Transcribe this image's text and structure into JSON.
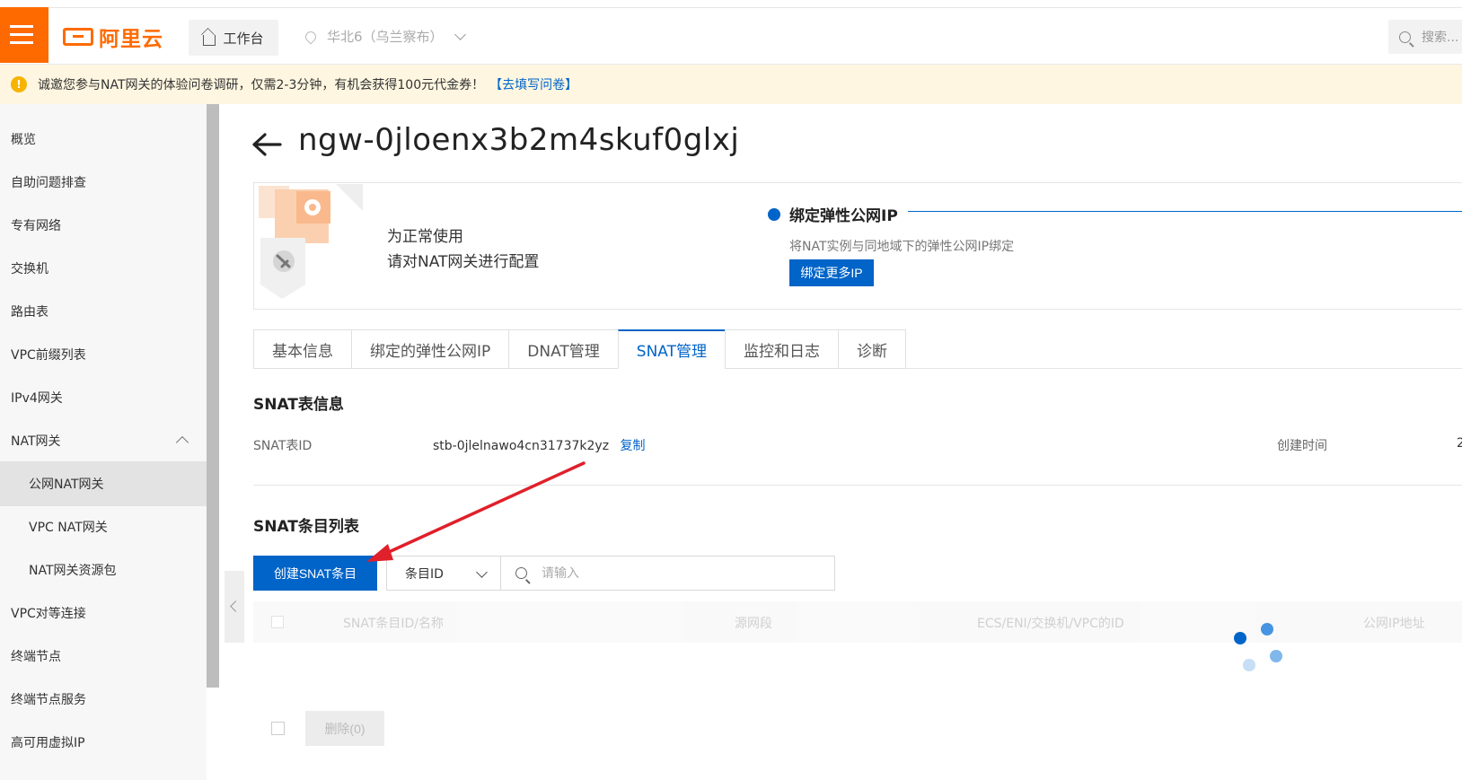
{
  "header": {
    "logo_text": "阿里云",
    "workbench_label": "工作台",
    "region_label": "华北6（乌兰察布）",
    "search_placeholder": "搜索..."
  },
  "notice": {
    "text": "诚邀您参与NAT网关的体验问卷调研，仅需2-3分钟，有机会获得100元代金券！",
    "link_label": "【去填写问卷】"
  },
  "sidebar": {
    "items": [
      {
        "label": "概览"
      },
      {
        "label": "自助问题排查"
      },
      {
        "label": "专有网络"
      },
      {
        "label": "交换机"
      },
      {
        "label": "路由表"
      },
      {
        "label": "VPC前缀列表"
      },
      {
        "label": "IPv4网关"
      },
      {
        "label": "NAT网关"
      },
      {
        "label": "公网NAT网关"
      },
      {
        "label": "VPC NAT网关"
      },
      {
        "label": "NAT网关资源包"
      },
      {
        "label": "VPC对等连接"
      },
      {
        "label": "终端节点"
      },
      {
        "label": "终端节点服务"
      },
      {
        "label": "高可用虚拟IP"
      }
    ]
  },
  "page": {
    "title": "ngw-0jloenx3b2m4skuf0glxj"
  },
  "status_card": {
    "line1": "为正常使用",
    "line2": "请对NAT网关进行配置",
    "step_title": "绑定弹性公网IP",
    "step_desc": "将NAT实例与同地域下的弹性公网IP绑定",
    "step_button": "绑定更多IP"
  },
  "tabs": [
    {
      "label": "基本信息"
    },
    {
      "label": "绑定的弹性公网IP"
    },
    {
      "label": "DNAT管理"
    },
    {
      "label": "SNAT管理"
    },
    {
      "label": "监控和日志"
    },
    {
      "label": "诊断"
    }
  ],
  "snat_info": {
    "section_title": "SNAT表信息",
    "id_label": "SNAT表ID",
    "id_value": "stb-0jlelnawo4cn31737k2yz",
    "copy_label": "复制",
    "created_label": "创建时间",
    "created_value": "2"
  },
  "snat_list": {
    "section_title": "SNAT条目列表",
    "create_button": "创建SNAT条目",
    "filter_selected": "条目ID",
    "search_placeholder": "请输入",
    "columns": [
      "SNAT条目ID/名称",
      "源网段",
      "ECS/ENI/交换机/VPC的ID",
      "公网IP地址"
    ],
    "delete_button": "删除(0)"
  },
  "colors": {
    "brand_orange": "#ff6a00",
    "primary_blue": "#0064c8",
    "annotation_red": "#e0202a"
  }
}
